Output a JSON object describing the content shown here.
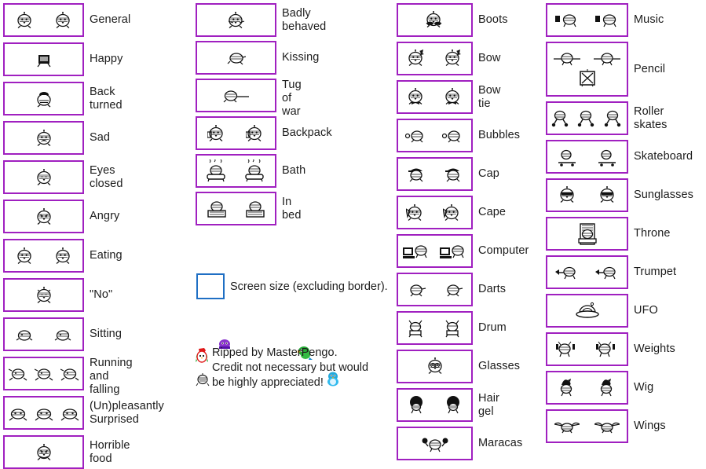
{
  "page": {
    "title": "Pengo / penguin character sprite sheet index",
    "background_color": "#ffffff",
    "box_border_color": "#a020c0",
    "legend_box_border_color": "#1f6fc4",
    "text_color": "#1c1c1c"
  },
  "columns": [
    {
      "id": "col-1",
      "entries": [
        {
          "label": "General",
          "sprite_count": 2,
          "sprite": "penguin-front"
        },
        {
          "label": "Happy",
          "sprite_count": 1,
          "sprite": "penguin-happy"
        },
        {
          "label": "Back turned",
          "sprite_count": 1,
          "sprite": "penguin-back"
        },
        {
          "label": "Sad",
          "sprite_count": 1,
          "sprite": "penguin-sad"
        },
        {
          "label": "Eyes closed",
          "sprite_count": 1,
          "sprite": "penguin-eyes-closed"
        },
        {
          "label": "Angry",
          "sprite_count": 1,
          "sprite": "penguin-angry"
        },
        {
          "label": "Eating",
          "sprite_count": 2,
          "sprite": "penguin-eating"
        },
        {
          "label": "\"No\"",
          "sprite_count": 1,
          "sprite": "penguin-no"
        },
        {
          "label": "Sitting",
          "sprite_count": 2,
          "sprite": "penguin-sitting"
        },
        {
          "label": "Running and falling",
          "sprite_count": 3,
          "sprite": "penguin-running"
        },
        {
          "label": "(Un)pleasantly\nSurprised",
          "sprite_count": 3,
          "sprite": "penguin-surprised"
        },
        {
          "label": "Horrible food",
          "sprite_count": 1,
          "sprite": "penguin-horrible-food"
        }
      ]
    },
    {
      "id": "col-2",
      "entries": [
        {
          "label": "Badly behaved",
          "sprite_count": 1,
          "sprite": "penguin-badly-behaved"
        },
        {
          "label": "Kissing",
          "sprite_count": 1,
          "sprite": "penguin-kissing"
        },
        {
          "label": "Tug of war",
          "sprite_count": 1,
          "sprite": "penguin-tug-of-war"
        },
        {
          "label": "Backpack",
          "sprite_count": 2,
          "sprite": "penguin-backpack"
        },
        {
          "label": "Bath",
          "sprite_count": 2,
          "sprite": "penguin-bath"
        },
        {
          "label": "In bed",
          "sprite_count": 2,
          "sprite": "penguin-in-bed"
        }
      ]
    },
    {
      "id": "col-3",
      "entries": [
        {
          "label": "Boots",
          "sprite_count": 1,
          "sprite": "penguin-boots"
        },
        {
          "label": "Bow",
          "sprite_count": 2,
          "sprite": "penguin-bow"
        },
        {
          "label": "Bow tie",
          "sprite_count": 2,
          "sprite": "penguin-bow-tie"
        },
        {
          "label": "Bubbles",
          "sprite_count": 2,
          "sprite": "penguin-bubbles"
        },
        {
          "label": "Cap",
          "sprite_count": 2,
          "sprite": "penguin-cap"
        },
        {
          "label": "Cape",
          "sprite_count": 2,
          "sprite": "penguin-cape"
        },
        {
          "label": "Computer",
          "sprite_count": 2,
          "sprite": "penguin-computer"
        },
        {
          "label": "Darts",
          "sprite_count": 2,
          "sprite": "penguin-darts"
        },
        {
          "label": "Drum",
          "sprite_count": 2,
          "sprite": "penguin-drum"
        },
        {
          "label": "Glasses",
          "sprite_count": 1,
          "sprite": "penguin-glasses"
        },
        {
          "label": "Hair gel",
          "sprite_count": 2,
          "sprite": "penguin-hair-gel"
        },
        {
          "label": "Maracas",
          "sprite_count": 1,
          "sprite": "penguin-maracas"
        }
      ]
    },
    {
      "id": "col-4",
      "entries": [
        {
          "label": "Music",
          "sprite_count": 2,
          "sprite": "penguin-music"
        },
        {
          "label": "Pencil",
          "sprite_count": 3,
          "sprite": "penguin-pencil"
        },
        {
          "label": "Roller skates",
          "sprite_count": 3,
          "sprite": "penguin-roller-skates"
        },
        {
          "label": "Skateboard",
          "sprite_count": 2,
          "sprite": "penguin-skateboard"
        },
        {
          "label": "Sunglasses",
          "sprite_count": 2,
          "sprite": "penguin-sunglasses"
        },
        {
          "label": "Throne",
          "sprite_count": 1,
          "sprite": "penguin-throne"
        },
        {
          "label": "Trumpet",
          "sprite_count": 2,
          "sprite": "penguin-trumpet"
        },
        {
          "label": "UFO",
          "sprite_count": 1,
          "sprite": "penguin-ufo"
        },
        {
          "label": "Weights",
          "sprite_count": 2,
          "sprite": "penguin-weights"
        },
        {
          "label": "Wig",
          "sprite_count": 2,
          "sprite": "penguin-wig"
        },
        {
          "label": "Wings",
          "sprite_count": 2,
          "sprite": "penguin-wings"
        }
      ]
    }
  ],
  "legend": {
    "screen_size_text": "Screen size (excluding border)."
  },
  "credit": {
    "text": "Ripped by MasterPengo.\nCredit not necessary but would\nbe highly appreciated!",
    "decorations": [
      {
        "name": "red-penguin",
        "color": "#e01818"
      },
      {
        "name": "purple-penguin",
        "color": "#8833cc"
      },
      {
        "name": "green-penguin",
        "color": "#22aa33"
      },
      {
        "name": "cyan-penguin",
        "color": "#22aadd"
      },
      {
        "name": "grey-penguin",
        "color": "#333333"
      }
    ]
  }
}
